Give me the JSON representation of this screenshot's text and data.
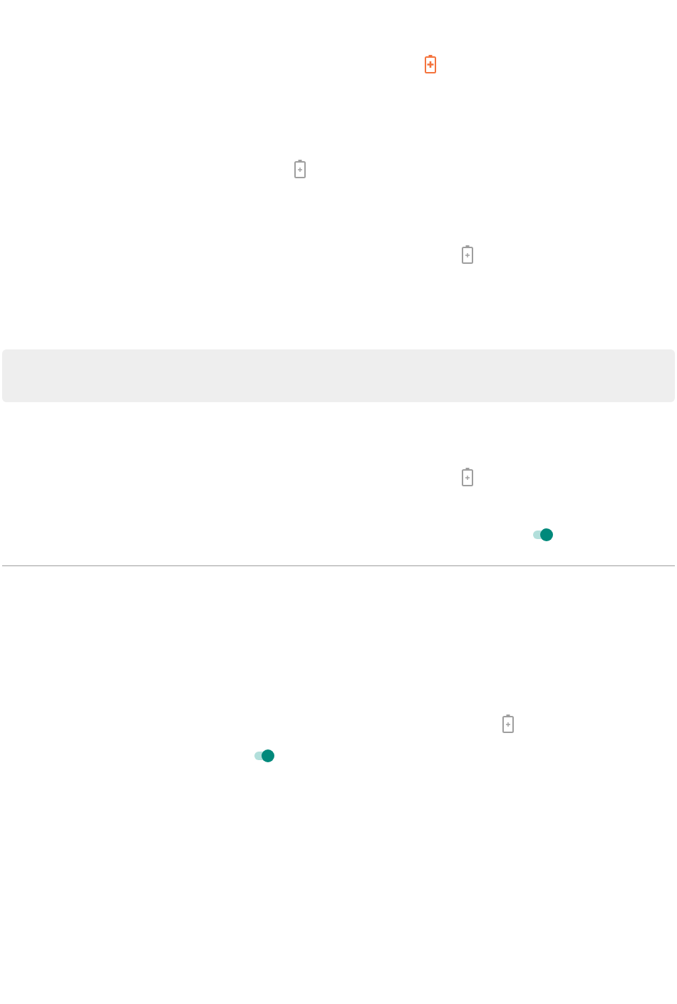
{
  "icons": [
    {
      "kind": "battery",
      "alert": true
    },
    {
      "kind": "battery",
      "alert": false
    },
    {
      "kind": "battery",
      "alert": false
    },
    {
      "kind": "battery",
      "alert": false
    },
    {
      "kind": "toggle",
      "on": true
    },
    {
      "kind": "battery",
      "alert": false
    },
    {
      "kind": "toggle",
      "on": true
    }
  ]
}
